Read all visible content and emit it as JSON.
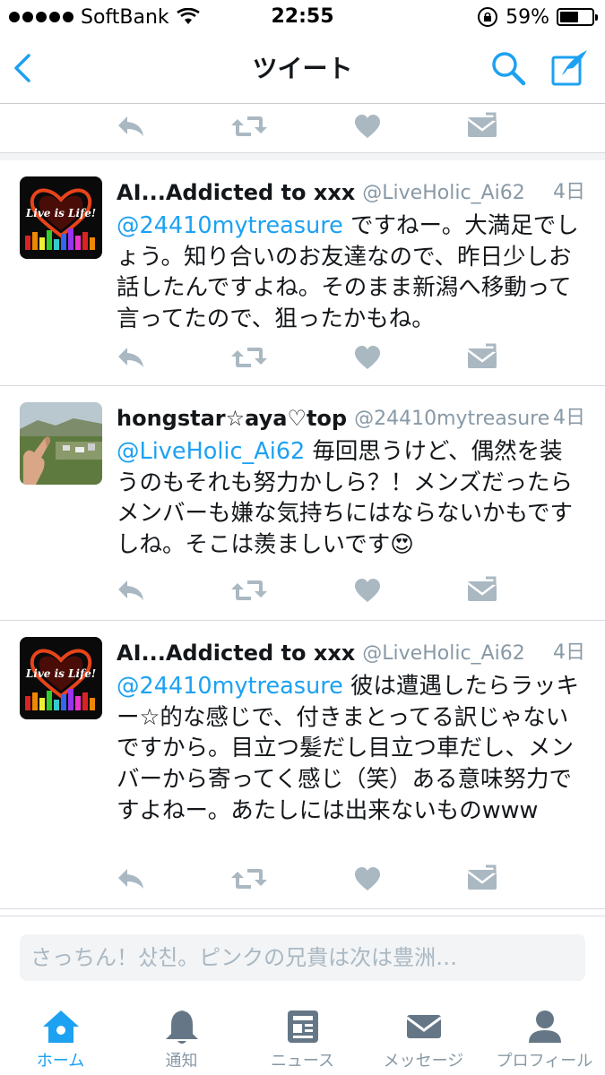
{
  "status_bar": {
    "carrier": "SoftBank",
    "time": "22:55",
    "battery_percent": "59%",
    "battery_level": 0.59
  },
  "nav": {
    "title": "ツイート",
    "icons": [
      "back-chevron-icon",
      "search-icon",
      "compose-icon"
    ]
  },
  "tweets": [
    {
      "display_name": "AI...Addicted to xxx",
      "screen_name": "@LiveHolic_Ai62",
      "time": "4日",
      "mention": "@24410mytreasure",
      "text": " ですねー。大満足でしょう。知り合いのお友達なので、昨日少しお話したんですよね。そのまま新潟へ移動って言ってたので、狙ったかもね。",
      "avatar_text": "Live is Life!"
    },
    {
      "display_name": "hongstar☆aya♡top",
      "screen_name": "@24410mytreasure",
      "time": "4日",
      "mention": "@LiveHolic_Ai62",
      "text": " 毎回思うけど、偶然を装うのもそれも努力かしら？！メンズだったらメンバーも嫌な気持ちにはならないかもですしね。そこは羨ましいです😍"
    },
    {
      "display_name": "AI...Addicted to xxx",
      "screen_name": "@LiveHolic_Ai62",
      "time": "4日",
      "mention": "@24410mytreasure",
      "text": " 彼は遭遇したらラッキー☆的な感じで、付きまとってる訳じゃないですから。目立つ髪だし目立つ車だし、メンバーから寄ってく感じ（笑）ある意味努力ですよねー。あたしには出来ないものwww",
      "avatar_text": "Live is Life!"
    }
  ],
  "action_icons": [
    "reply-icon",
    "retweet-icon",
    "like-icon",
    "direct-message-icon"
  ],
  "compose": {
    "placeholder": "さっちん！샀친。ピンクの兄貴は次は豊洲…"
  },
  "tab_bar": {
    "active": "home",
    "tabs": [
      {
        "id": "home",
        "label": "ホーム",
        "icon": "home-icon"
      },
      {
        "id": "notifications",
        "label": "通知",
        "icon": "bell-icon"
      },
      {
        "id": "news",
        "label": "ニュース",
        "icon": "news-icon"
      },
      {
        "id": "messages",
        "label": "メッセージ",
        "icon": "envelope-icon"
      },
      {
        "id": "profile",
        "label": "プロフィール",
        "icon": "person-icon"
      }
    ]
  },
  "colors": {
    "accent": "#1da1f2",
    "muted": "#8899a6",
    "action_icon": "#aab8c2",
    "divider": "#d6dbe0"
  }
}
